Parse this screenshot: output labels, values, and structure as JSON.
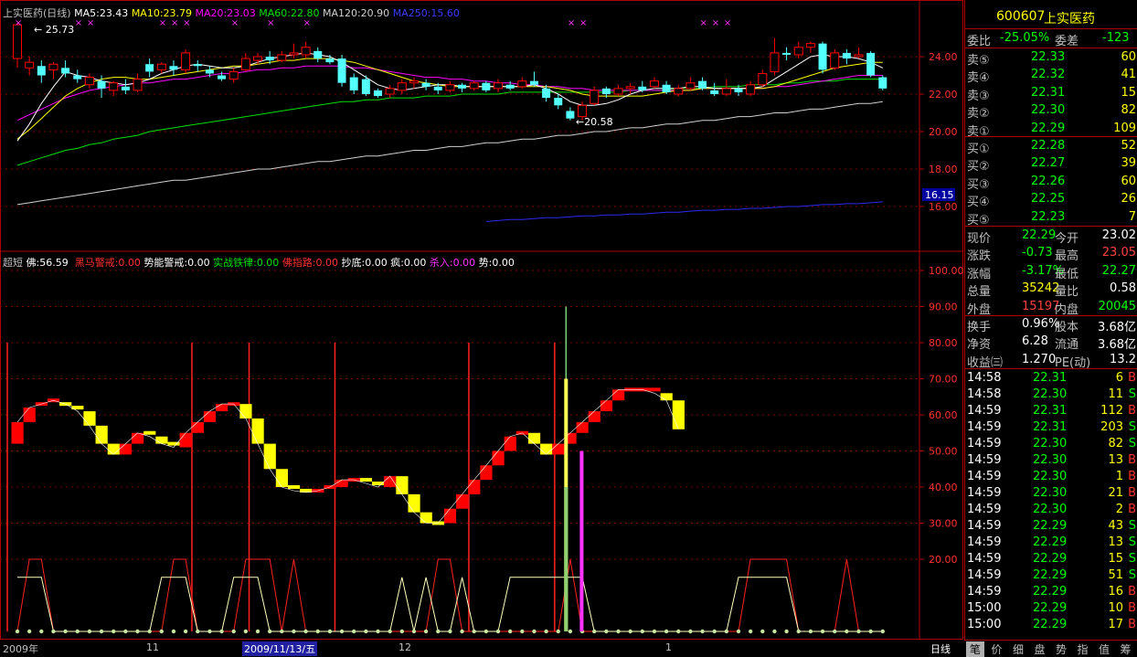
{
  "colors": {
    "up": "#ff0000",
    "down": "#54ffff",
    "ma5": "#ffffff",
    "ma10": "#ffff00",
    "ma20": "#ff00ff",
    "ma60": "#00e000",
    "ma120": "#d0d0d0",
    "ma250": "#2a2af0",
    "bear": "#ffff00"
  },
  "legend": {
    "title": "上实医药(日线)",
    "ma5": "MA5:23.43",
    "ma10": "MA10:23.79",
    "ma20": "MA20:23.03",
    "ma60": "MA60:22.80",
    "ma120": "MA120:20.90",
    "ma250": "MA250:15.60"
  },
  "price_axis": [
    "24.00",
    "22.00",
    "20.00",
    "18.00",
    "16.00"
  ],
  "price_marker": "16.15",
  "annot_high": "25.73",
  "annot_low": "←20.58",
  "indicator_legend": {
    "name": "超短",
    "fo": "佛:56.59",
    "heima": "黑马警戒:0.00",
    "shineng": "势能警戒:0.00",
    "shizhan": "实战铁律:0.00",
    "fozhi": "佛指路:0.00",
    "chaodi": "抄底:0.00",
    "feng": "疯:0.00",
    "shaRu": "杀入:0.00",
    "shi": "势:0.00"
  },
  "ind_axis": [
    "100.00",
    "90.00",
    "80.00",
    "70.00",
    "60.00",
    "50.00",
    "40.00",
    "30.00",
    "20.00"
  ],
  "dates": {
    "d1": "2009年",
    "d2": "11",
    "d3": "2009/11/13/五",
    "d4": "12",
    "d5": "1",
    "period": "日线"
  },
  "chart_data": {
    "type": "candlestick",
    "ylim": [
      15.2,
      25.8
    ],
    "candles": [
      [
        23.9,
        25.7,
        25.8,
        23.4
      ],
      [
        23.4,
        23.7,
        24.0,
        23.0
      ],
      [
        23.5,
        23.0,
        23.8,
        22.6
      ],
      [
        23.3,
        23.6,
        23.7,
        22.8
      ],
      [
        23.4,
        23.1,
        23.8,
        22.9
      ],
      [
        23.0,
        22.8,
        23.3,
        22.6
      ],
      [
        22.5,
        22.9,
        23.1,
        22.3
      ],
      [
        22.7,
        22.3,
        23.0,
        21.8
      ],
      [
        22.2,
        22.6,
        22.7,
        21.9
      ],
      [
        22.4,
        22.2,
        22.8,
        22.0
      ],
      [
        22.2,
        22.8,
        23.1,
        22.1
      ],
      [
        23.6,
        23.2,
        23.9,
        22.9
      ],
      [
        23.3,
        23.6,
        23.7,
        23.1
      ],
      [
        23.5,
        23.3,
        23.8,
        23.0
      ],
      [
        23.3,
        24.2,
        24.4,
        23.1
      ],
      [
        23.6,
        23.5,
        23.8,
        23.2
      ],
      [
        23.3,
        23.1,
        23.5,
        22.9
      ],
      [
        23.0,
        22.8,
        23.2,
        22.7
      ],
      [
        22.8,
        23.2,
        23.4,
        22.6
      ],
      [
        23.3,
        23.9,
        24.2,
        23.2
      ],
      [
        23.8,
        24.0,
        24.2,
        23.6
      ],
      [
        24.0,
        23.8,
        24.3,
        23.6
      ],
      [
        23.8,
        24.1,
        24.3,
        23.7
      ],
      [
        24.1,
        24.2,
        24.7,
        23.9
      ],
      [
        24.1,
        24.5,
        24.8,
        23.9
      ],
      [
        24.3,
        23.9,
        24.5,
        23.7
      ],
      [
        23.9,
        23.7,
        24.1,
        23.6
      ],
      [
        23.9,
        22.6,
        24.1,
        22.4
      ],
      [
        22.9,
        22.2,
        23.1,
        22.0
      ],
      [
        22.8,
        22.0,
        23.0,
        21.9
      ],
      [
        22.2,
        21.9,
        22.3,
        21.8
      ],
      [
        22.0,
        22.3,
        22.5,
        21.8
      ],
      [
        22.2,
        22.6,
        22.8,
        22.0
      ],
      [
        22.6,
        22.7,
        22.9,
        22.3
      ],
      [
        22.6,
        22.4,
        22.8,
        22.2
      ],
      [
        22.4,
        22.2,
        22.6,
        22.0
      ],
      [
        22.2,
        22.5,
        22.7,
        22.1
      ],
      [
        22.5,
        22.3,
        22.6,
        22.1
      ],
      [
        22.3,
        22.6,
        22.7,
        22.2
      ],
      [
        22.6,
        22.2,
        22.7,
        22.1
      ],
      [
        22.3,
        22.6,
        22.8,
        22.1
      ],
      [
        22.5,
        22.3,
        22.7,
        22.2
      ],
      [
        22.4,
        22.7,
        22.9,
        22.3
      ],
      [
        22.7,
        22.5,
        23.2,
        22.4
      ],
      [
        22.3,
        21.8,
        22.5,
        21.6
      ],
      [
        21.8,
        21.4,
        22.0,
        21.2
      ],
      [
        21.1,
        20.7,
        21.3,
        20.6
      ],
      [
        20.8,
        21.4,
        21.6,
        20.6
      ],
      [
        21.5,
        22.2,
        22.4,
        21.4
      ],
      [
        22.3,
        22.0,
        22.4,
        21.8
      ],
      [
        22.0,
        22.3,
        22.5,
        21.9
      ],
      [
        22.3,
        22.4,
        22.6,
        22.0
      ],
      [
        22.4,
        22.2,
        22.7,
        22.1
      ],
      [
        22.4,
        22.7,
        22.9,
        22.3
      ],
      [
        22.5,
        22.1,
        22.7,
        22.0
      ],
      [
        22.0,
        22.3,
        22.5,
        21.9
      ],
      [
        22.3,
        22.6,
        22.9,
        22.2
      ],
      [
        22.7,
        22.3,
        22.9,
        22.2
      ],
      [
        22.2,
        22.0,
        22.6,
        21.9
      ],
      [
        22.0,
        22.3,
        22.8,
        21.9
      ],
      [
        22.3,
        22.1,
        22.5,
        21.9
      ],
      [
        22.0,
        22.5,
        22.7,
        21.9
      ],
      [
        22.5,
        23.1,
        23.3,
        22.4
      ],
      [
        23.2,
        24.2,
        25.0,
        23.0
      ],
      [
        24.2,
        24.1,
        24.5,
        23.8
      ],
      [
        24.1,
        24.5,
        24.8,
        23.9
      ],
      [
        24.5,
        24.7,
        24.8,
        24.2
      ],
      [
        24.7,
        23.3,
        24.8,
        23.1
      ],
      [
        23.4,
        24.2,
        24.4,
        23.3
      ],
      [
        24.2,
        23.9,
        24.4,
        23.6
      ],
      [
        24.0,
        24.1,
        24.5,
        23.9
      ],
      [
        24.2,
        23.0,
        24.3,
        22.9
      ],
      [
        22.9,
        22.3,
        23.0,
        22.2
      ]
    ],
    "ma5": [
      19.5,
      20.4,
      21.5,
      22.4,
      23.2,
      23.0,
      22.9,
      22.7,
      22.6,
      22.5,
      22.6,
      22.8,
      23.1,
      23.3,
      23.5,
      23.6,
      23.5,
      23.4,
      23.4,
      23.5,
      23.7,
      23.9,
      24.0,
      24.1,
      24.2,
      24.1,
      24.0,
      23.7,
      23.3,
      22.9,
      22.5,
      22.3,
      22.2,
      22.3,
      22.4,
      22.5,
      22.5,
      22.4,
      22.4,
      22.4,
      22.4,
      22.4,
      22.4,
      22.5,
      22.3,
      22.0,
      21.6,
      21.4,
      21.4,
      21.5,
      21.7,
      22.0,
      22.2,
      22.3,
      22.3,
      22.3,
      22.4,
      22.4,
      22.3,
      22.3,
      22.3,
      22.3,
      22.4,
      22.8,
      23.2,
      23.6,
      24.0,
      24.1,
      24.0,
      24.0,
      23.9,
      23.7,
      23.4
    ],
    "ma10": [
      19.6,
      20.1,
      20.7,
      21.3,
      21.9,
      22.3,
      22.6,
      22.8,
      22.9,
      22.9,
      22.8,
      22.8,
      22.9,
      23.0,
      23.1,
      23.2,
      23.3,
      23.4,
      23.5,
      23.5,
      23.6,
      23.7,
      23.8,
      23.8,
      23.9,
      23.9,
      23.9,
      23.8,
      23.7,
      23.5,
      23.3,
      23.1,
      22.9,
      22.7,
      22.6,
      22.5,
      22.4,
      22.4,
      22.4,
      22.4,
      22.4,
      22.4,
      22.4,
      22.4,
      22.4,
      22.3,
      22.2,
      22.0,
      21.9,
      21.9,
      21.9,
      21.9,
      21.9,
      22.0,
      22.1,
      22.2,
      22.2,
      22.3,
      22.3,
      22.3,
      22.3,
      22.3,
      22.3,
      22.4,
      22.6,
      22.8,
      23.0,
      23.2,
      23.4,
      23.5,
      23.6,
      23.7,
      23.7
    ],
    "ma20": [
      20.6,
      20.9,
      21.2,
      21.5,
      21.8,
      22.0,
      22.2,
      22.3,
      22.4,
      22.5,
      22.6,
      22.6,
      22.7,
      22.8,
      22.8,
      22.9,
      23.0,
      23.1,
      23.1,
      23.2,
      23.3,
      23.3,
      23.4,
      23.4,
      23.5,
      23.5,
      23.5,
      23.5,
      23.4,
      23.4,
      23.3,
      23.2,
      23.1,
      23.0,
      22.9,
      22.9,
      22.8,
      22.8,
      22.7,
      22.7,
      22.6,
      22.6,
      22.5,
      22.5,
      22.4,
      22.4,
      22.3,
      22.3,
      22.2,
      22.2,
      22.2,
      22.2,
      22.2,
      22.2,
      22.2,
      22.2,
      22.2,
      22.3,
      22.3,
      22.3,
      22.3,
      22.3,
      22.3,
      22.4,
      22.4,
      22.5,
      22.6,
      22.7,
      22.8,
      22.9,
      23.0,
      23.0,
      23.0
    ],
    "ma60": [
      18.2,
      18.4,
      18.6,
      18.8,
      19.0,
      19.1,
      19.3,
      19.4,
      19.6,
      19.7,
      19.8,
      20.0,
      20.1,
      20.2,
      20.3,
      20.4,
      20.5,
      20.6,
      20.7,
      20.8,
      20.9,
      21.0,
      21.1,
      21.2,
      21.3,
      21.4,
      21.5,
      21.6,
      21.6,
      21.7,
      21.7,
      21.8,
      21.8,
      21.8,
      21.9,
      21.9,
      21.9,
      22.0,
      22.0,
      22.0,
      22.0,
      22.1,
      22.1,
      22.1,
      22.1,
      22.1,
      22.1,
      22.1,
      22.1,
      22.1,
      22.1,
      22.2,
      22.2,
      22.2,
      22.2,
      22.3,
      22.3,
      22.3,
      22.4,
      22.4,
      22.4,
      22.5,
      22.5,
      22.5,
      22.6,
      22.6,
      22.7,
      22.7,
      22.7,
      22.8,
      22.8,
      22.8,
      22.8
    ],
    "ma120": [
      16.1,
      16.2,
      16.3,
      16.4,
      16.5,
      16.6,
      16.7,
      16.8,
      16.9,
      17.0,
      17.1,
      17.2,
      17.3,
      17.4,
      17.4,
      17.5,
      17.6,
      17.7,
      17.8,
      17.9,
      18.0,
      18.0,
      18.1,
      18.2,
      18.3,
      18.4,
      18.4,
      18.5,
      18.6,
      18.7,
      18.7,
      18.8,
      18.9,
      19.0,
      19.0,
      19.1,
      19.2,
      19.2,
      19.3,
      19.4,
      19.4,
      19.5,
      19.6,
      19.6,
      19.7,
      19.8,
      19.8,
      19.9,
      20.0,
      20.0,
      20.1,
      20.2,
      20.2,
      20.3,
      20.4,
      20.4,
      20.5,
      20.6,
      20.6,
      20.7,
      20.8,
      20.8,
      20.9,
      21.0,
      21.0,
      21.1,
      21.2,
      21.2,
      21.3,
      21.4,
      21.5,
      21.5,
      21.6
    ],
    "ma250_start_index": 39,
    "ma250": [
      15.2,
      15.25,
      15.3,
      15.3,
      15.35,
      15.4,
      15.4,
      15.45,
      15.5,
      15.5,
      15.55,
      15.55,
      15.6,
      15.6,
      15.65,
      15.7,
      15.7,
      15.75,
      15.8,
      15.8,
      15.85,
      15.85,
      15.9,
      15.9,
      15.95,
      16.0,
      16.0,
      16.05,
      16.1,
      16.1,
      16.15,
      16.15,
      16.2,
      16.25
    ],
    "signals": [
      0,
      5,
      6,
      12,
      13,
      14,
      18,
      21,
      24,
      46,
      47,
      57,
      58,
      59
    ],
    "indicator": {
      "ylim": [
        0,
        100
      ],
      "vlines": [
        0,
        13,
        17,
        23,
        33,
        39
      ],
      "blocks": [
        [
          52,
          58,
          1
        ],
        [
          58,
          62,
          1
        ],
        [
          62,
          63,
          1
        ],
        [
          63,
          64,
          1
        ],
        [
          63,
          63,
          0
        ],
        [
          62,
          61,
          0
        ],
        [
          61,
          57,
          0
        ],
        [
          57,
          52,
          0
        ],
        [
          52,
          49,
          0
        ],
        [
          49,
          52,
          1
        ],
        [
          52,
          55,
          1
        ],
        [
          55,
          54,
          0
        ],
        [
          54,
          52,
          0
        ],
        [
          52,
          51,
          0
        ],
        [
          51,
          55,
          1
        ],
        [
          55,
          58,
          1
        ],
        [
          58,
          61,
          1
        ],
        [
          61,
          63,
          1
        ],
        [
          63,
          63,
          1
        ],
        [
          63,
          59,
          0
        ],
        [
          59,
          52,
          0
        ],
        [
          52,
          45,
          0
        ],
        [
          45,
          40,
          0
        ],
        [
          40,
          39,
          0
        ],
        [
          39,
          38.5,
          0
        ],
        [
          38.5,
          39,
          1
        ],
        [
          39,
          40,
          1
        ],
        [
          40,
          42,
          1
        ],
        [
          42,
          42,
          1
        ],
        [
          42,
          41,
          0
        ],
        [
          41,
          40,
          0
        ],
        [
          40,
          43,
          1
        ],
        [
          43,
          38,
          0
        ],
        [
          38,
          33,
          0
        ],
        [
          33,
          30,
          0
        ],
        [
          30,
          30,
          0
        ],
        [
          30,
          34,
          1
        ],
        [
          34,
          38,
          1
        ],
        [
          38,
          42,
          1
        ],
        [
          42,
          46,
          1
        ],
        [
          46,
          50,
          1
        ],
        [
          50,
          54,
          1
        ],
        [
          54,
          55,
          1
        ],
        [
          55,
          52,
          0
        ],
        [
          52,
          49,
          0
        ],
        [
          49,
          52,
          1
        ],
        [
          52,
          55,
          1
        ],
        [
          55,
          58,
          1
        ],
        [
          58,
          61,
          1
        ],
        [
          61,
          64,
          1
        ],
        [
          64,
          67,
          1
        ],
        [
          67,
          67,
          1
        ],
        [
          67,
          67,
          1
        ],
        [
          67,
          66,
          1
        ],
        [
          66,
          64,
          0
        ],
        [
          64,
          56,
          0
        ]
      ],
      "spikes": [
        {
          "i": 42,
          "v": 90,
          "color": "#7dd87d"
        },
        {
          "i": 42,
          "v": 70,
          "color": "#ffff55"
        },
        {
          "i": 42,
          "v": 40,
          "color": "#8fd070"
        },
        {
          "i": 43.3,
          "v": 50,
          "color": "#ff33ff"
        }
      ]
    }
  },
  "panel": {
    "code": "600607",
    "name": "上实医药",
    "weibi_label": "委比",
    "weibi": "-25.05%",
    "weicha_label": "委差",
    "weicha": "-123",
    "sells": [
      {
        "label": "卖⑤",
        "price": "22.33",
        "vol": "60"
      },
      {
        "label": "卖④",
        "price": "22.32",
        "vol": "41"
      },
      {
        "label": "卖③",
        "price": "22.31",
        "vol": "15"
      },
      {
        "label": "卖②",
        "price": "22.30",
        "vol": "82"
      },
      {
        "label": "卖①",
        "price": "22.29",
        "vol": "109"
      }
    ],
    "buys": [
      {
        "label": "买①",
        "price": "22.28",
        "vol": "52"
      },
      {
        "label": "买②",
        "price": "22.27",
        "vol": "39"
      },
      {
        "label": "买③",
        "price": "22.26",
        "vol": "60"
      },
      {
        "label": "买④",
        "price": "22.25",
        "vol": "26"
      },
      {
        "label": "买⑤",
        "price": "22.23",
        "vol": "7"
      }
    ],
    "stats": [
      {
        "l1": "现价",
        "v1": "22.29",
        "c1": "#00ff00",
        "l2": "今开",
        "v2": "23.02",
        "c2": "#ffffff"
      },
      {
        "l1": "涨跌",
        "v1": "-0.73",
        "c1": "#00ff00",
        "l2": "最高",
        "v2": "23.05",
        "c2": "#ff4040"
      },
      {
        "l1": "涨幅",
        "v1": "-3.17%",
        "c1": "#00ff00",
        "l2": "最低",
        "v2": "22.27",
        "c2": "#00ff00"
      },
      {
        "l1": "总量",
        "v1": "35242",
        "c1": "#ffff00",
        "l2": "量比",
        "v2": "0.58",
        "c2": "#ffffff"
      },
      {
        "l1": "外盘",
        "v1": "15197",
        "c1": "#ff4040",
        "l2": "内盘",
        "v2": "20045",
        "c2": "#00ff00"
      }
    ],
    "stats2": [
      {
        "l1": "换手",
        "v1": "0.96%",
        "l2": "股本",
        "v2": "3.68亿"
      },
      {
        "l1": "净资",
        "v1": "6.28",
        "l2": "流通",
        "v2": "3.68亿"
      },
      {
        "l1": "收益㈢",
        "v1": "1.270",
        "l2": "PE(动)",
        "v2": "13.2"
      }
    ],
    "ticks": [
      {
        "t": "14:58",
        "p": "22.31",
        "v": "6",
        "s": "B"
      },
      {
        "t": "14:58",
        "p": "22.30",
        "v": "11",
        "s": "S"
      },
      {
        "t": "14:59",
        "p": "22.31",
        "v": "112",
        "s": "B"
      },
      {
        "t": "14:59",
        "p": "22.31",
        "v": "203",
        "s": "S"
      },
      {
        "t": "14:59",
        "p": "22.30",
        "v": "82",
        "s": "S"
      },
      {
        "t": "14:59",
        "p": "22.30",
        "v": "13",
        "s": "B"
      },
      {
        "t": "14:59",
        "p": "22.30",
        "v": "1",
        "s": "B"
      },
      {
        "t": "14:59",
        "p": "22.30",
        "v": "21",
        "s": "B"
      },
      {
        "t": "14:59",
        "p": "22.30",
        "v": "2",
        "s": "B"
      },
      {
        "t": "14:59",
        "p": "22.29",
        "v": "43",
        "s": "S"
      },
      {
        "t": "14:59",
        "p": "22.29",
        "v": "13",
        "s": "S"
      },
      {
        "t": "14:59",
        "p": "22.29",
        "v": "15",
        "s": "S"
      },
      {
        "t": "14:59",
        "p": "22.29",
        "v": "51",
        "s": "S"
      },
      {
        "t": "14:59",
        "p": "22.29",
        "v": "16",
        "s": "B"
      },
      {
        "t": "15:00",
        "p": "22.29",
        "v": "10",
        "s": "B"
      },
      {
        "t": "15:00",
        "p": "22.29",
        "v": "17",
        "s": "B"
      }
    ],
    "tabs": [
      "笔",
      "价",
      "细",
      "盘",
      "势",
      "指",
      "值",
      "筹"
    ]
  }
}
